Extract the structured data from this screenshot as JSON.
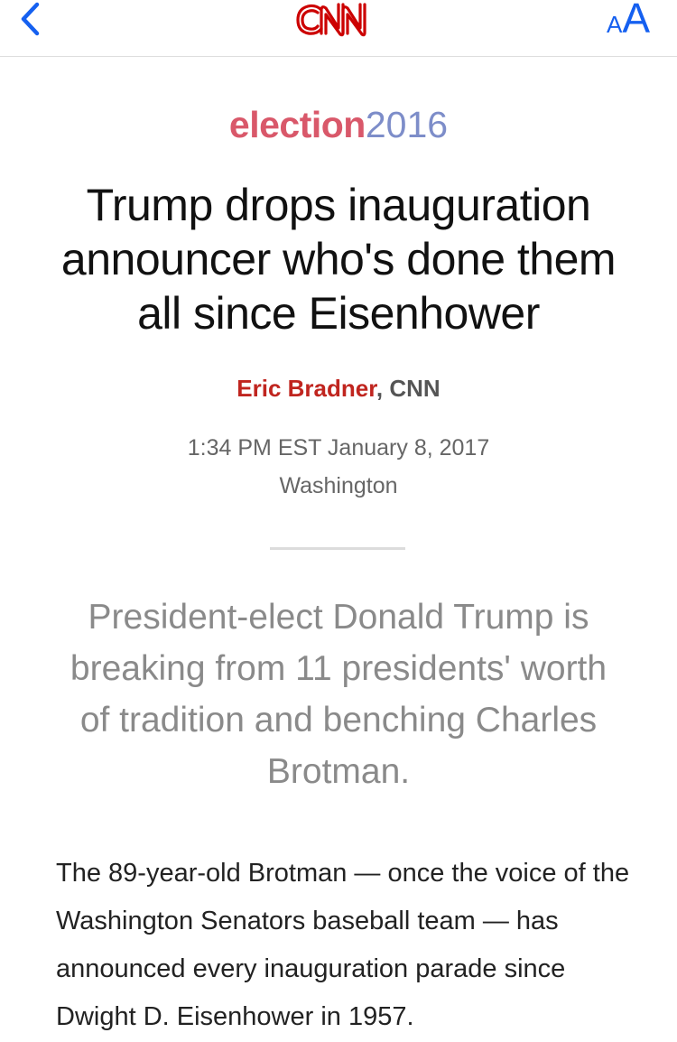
{
  "navbar": {
    "back_icon": "chevron-left-icon",
    "logo_text": "CNN",
    "logo_color": "#cc0000",
    "textsize_small": "A",
    "textsize_large": "A",
    "accent_color": "#1560f0"
  },
  "section": {
    "word": "election",
    "year": "2016"
  },
  "article": {
    "headline": "Trump drops inauguration announcer who's done them all since Eisenhower",
    "author": "Eric Bradner",
    "separator": ",",
    "source": "CNN",
    "timestamp": "1:34 PM EST January 8, 2017",
    "dateline": "Washington",
    "standfirst": "President-elect Donald Trump is breaking from 11 presidents' worth of tradition and benching Charles Brotman.",
    "body": "The 89-year-old Brotman — once the voice of the Washington Senators baseball team — has announced every inauguration parade since Dwight D. Eisenhower in 1957."
  }
}
